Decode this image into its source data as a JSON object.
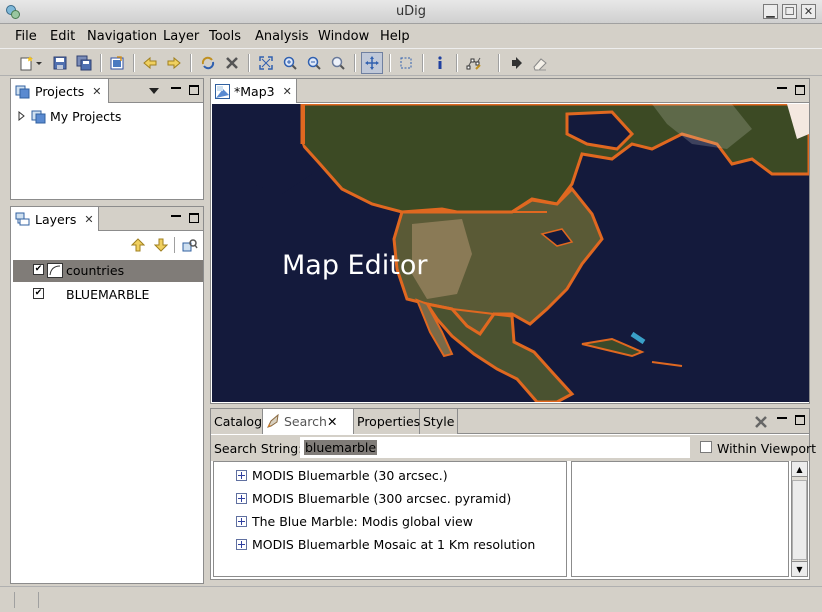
{
  "window": {
    "title": "uDig"
  },
  "menu": [
    "File",
    "Edit",
    "Navigation",
    "Layer",
    "Tools",
    "Analysis",
    "Window",
    "Help"
  ],
  "projects_view": {
    "tab_label": "Projects",
    "tree": [
      {
        "label": "My Projects"
      }
    ]
  },
  "layers_view": {
    "tab_label": "Layers",
    "layers": [
      {
        "label": "countries",
        "checked": true,
        "selected": true
      },
      {
        "label": "BLUEMARBLE",
        "checked": true,
        "selected": false
      }
    ]
  },
  "map_editor": {
    "tab_label": "*Map3",
    "overlay_label": "Map Editor"
  },
  "bottom_panel": {
    "tabs": [
      "Catalog",
      "Search",
      "Properties",
      "Style"
    ],
    "active_tab": "Search",
    "search_label": "Search String:",
    "search_value": "bluemarble",
    "within_viewport_label": "Within Viewport",
    "within_viewport_checked": false,
    "results": [
      "MODIS Bluemarble (30 arcsec.)",
      "MODIS Bluemarble (300 arcsec. pyramid)",
      "The Blue Marble: Modis global view",
      "MODIS Bluemarble Mosaic at 1 Km resolution"
    ]
  },
  "colors": {
    "selection": "#807c78",
    "coast": "#e06820",
    "ocean": "#141a3c"
  }
}
